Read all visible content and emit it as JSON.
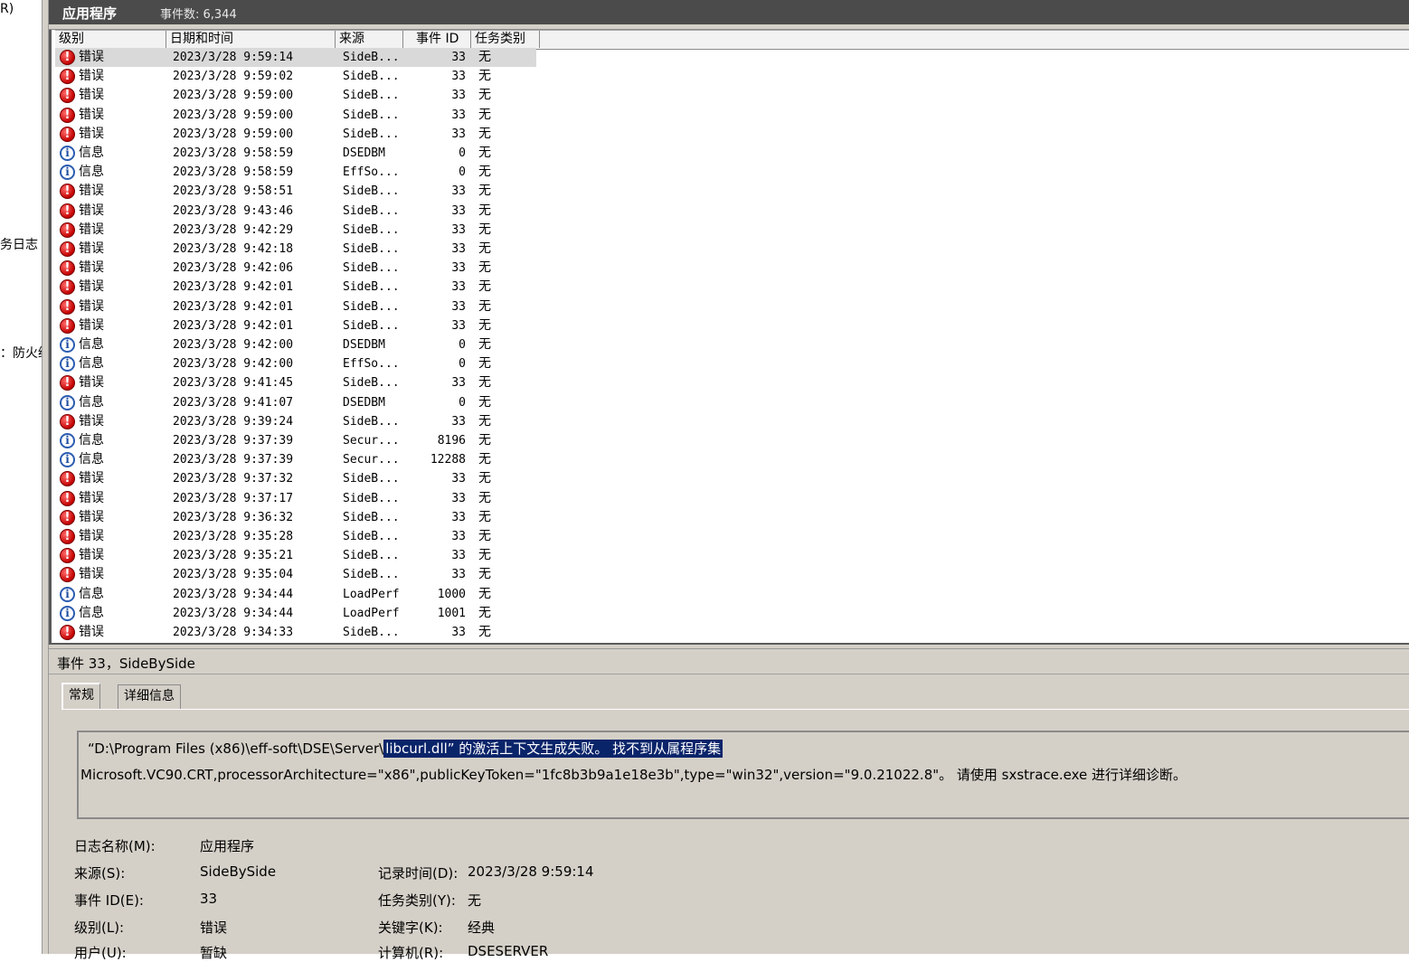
{
  "left_tree": {
    "frag_top": "R)",
    "frag_mid": "务日志",
    "frag_low": "：防火缙"
  },
  "title": {
    "name": "应用程序",
    "count": "事件数: 6,344"
  },
  "columns": {
    "level": "级别",
    "datetime": "日期和时间",
    "source": "来源",
    "event_id": "事件 ID",
    "task": "任务类别"
  },
  "events": [
    {
      "type": "err",
      "level": "错误",
      "dt": "2023/3/28 9:59:14",
      "src": "SideB...",
      "id": "33",
      "task": "无",
      "selected": true
    },
    {
      "type": "err",
      "level": "错误",
      "dt": "2023/3/28 9:59:02",
      "src": "SideB...",
      "id": "33",
      "task": "无"
    },
    {
      "type": "err",
      "level": "错误",
      "dt": "2023/3/28 9:59:00",
      "src": "SideB...",
      "id": "33",
      "task": "无"
    },
    {
      "type": "err",
      "level": "错误",
      "dt": "2023/3/28 9:59:00",
      "src": "SideB...",
      "id": "33",
      "task": "无"
    },
    {
      "type": "err",
      "level": "错误",
      "dt": "2023/3/28 9:59:00",
      "src": "SideB...",
      "id": "33",
      "task": "无"
    },
    {
      "type": "info",
      "level": "信息",
      "dt": "2023/3/28 9:58:59",
      "src": "DSEDBM",
      "id": "0",
      "task": "无"
    },
    {
      "type": "info",
      "level": "信息",
      "dt": "2023/3/28 9:58:59",
      "src": "EffSo...",
      "id": "0",
      "task": "无"
    },
    {
      "type": "err",
      "level": "错误",
      "dt": "2023/3/28 9:58:51",
      "src": "SideB...",
      "id": "33",
      "task": "无"
    },
    {
      "type": "err",
      "level": "错误",
      "dt": "2023/3/28 9:43:46",
      "src": "SideB...",
      "id": "33",
      "task": "无"
    },
    {
      "type": "err",
      "level": "错误",
      "dt": "2023/3/28 9:42:29",
      "src": "SideB...",
      "id": "33",
      "task": "无"
    },
    {
      "type": "err",
      "level": "错误",
      "dt": "2023/3/28 9:42:18",
      "src": "SideB...",
      "id": "33",
      "task": "无"
    },
    {
      "type": "err",
      "level": "错误",
      "dt": "2023/3/28 9:42:06",
      "src": "SideB...",
      "id": "33",
      "task": "无"
    },
    {
      "type": "err",
      "level": "错误",
      "dt": "2023/3/28 9:42:01",
      "src": "SideB...",
      "id": "33",
      "task": "无"
    },
    {
      "type": "err",
      "level": "错误",
      "dt": "2023/3/28 9:42:01",
      "src": "SideB...",
      "id": "33",
      "task": "无"
    },
    {
      "type": "err",
      "level": "错误",
      "dt": "2023/3/28 9:42:01",
      "src": "SideB...",
      "id": "33",
      "task": "无"
    },
    {
      "type": "info",
      "level": "信息",
      "dt": "2023/3/28 9:42:00",
      "src": "DSEDBM",
      "id": "0",
      "task": "无"
    },
    {
      "type": "info",
      "level": "信息",
      "dt": "2023/3/28 9:42:00",
      "src": "EffSo...",
      "id": "0",
      "task": "无"
    },
    {
      "type": "err",
      "level": "错误",
      "dt": "2023/3/28 9:41:45",
      "src": "SideB...",
      "id": "33",
      "task": "无"
    },
    {
      "type": "info",
      "level": "信息",
      "dt": "2023/3/28 9:41:07",
      "src": "DSEDBM",
      "id": "0",
      "task": "无"
    },
    {
      "type": "err",
      "level": "错误",
      "dt": "2023/3/28 9:39:24",
      "src": "SideB...",
      "id": "33",
      "task": "无"
    },
    {
      "type": "info",
      "level": "信息",
      "dt": "2023/3/28 9:37:39",
      "src": "Secur...",
      "id": "8196",
      "task": "无"
    },
    {
      "type": "info",
      "level": "信息",
      "dt": "2023/3/28 9:37:39",
      "src": "Secur...",
      "id": "12288",
      "task": "无"
    },
    {
      "type": "err",
      "level": "错误",
      "dt": "2023/3/28 9:37:32",
      "src": "SideB...",
      "id": "33",
      "task": "无"
    },
    {
      "type": "err",
      "level": "错误",
      "dt": "2023/3/28 9:37:17",
      "src": "SideB...",
      "id": "33",
      "task": "无"
    },
    {
      "type": "err",
      "level": "错误",
      "dt": "2023/3/28 9:36:32",
      "src": "SideB...",
      "id": "33",
      "task": "无"
    },
    {
      "type": "err",
      "level": "错误",
      "dt": "2023/3/28 9:35:28",
      "src": "SideB...",
      "id": "33",
      "task": "无"
    },
    {
      "type": "err",
      "level": "错误",
      "dt": "2023/3/28 9:35:21",
      "src": "SideB...",
      "id": "33",
      "task": "无"
    },
    {
      "type": "err",
      "level": "错误",
      "dt": "2023/3/28 9:35:04",
      "src": "SideB...",
      "id": "33",
      "task": "无"
    },
    {
      "type": "info",
      "level": "信息",
      "dt": "2023/3/28 9:34:44",
      "src": "LoadPerf",
      "id": "1000",
      "task": "无"
    },
    {
      "type": "info",
      "level": "信息",
      "dt": "2023/3/28 9:34:44",
      "src": "LoadPerf",
      "id": "1001",
      "task": "无"
    },
    {
      "type": "err",
      "level": "错误",
      "dt": "2023/3/28 9:34:33",
      "src": "SideB...",
      "id": "33",
      "task": "无"
    }
  ],
  "details": {
    "header": "事件 33，SideBySide",
    "tabs": {
      "general": "常规",
      "detail": "详细信息"
    },
    "message_line1_pre": "“D:\\Program Files (x86)\\eff-soft\\DSE\\Server\\",
    "message_line1_sel": "libcurl.dll” 的激活上下文生成失败。 找不到从属程序集",
    "message_line2": "Microsoft.VC90.CRT,processorArchitecture=\"x86\",publicKeyToken=\"1fc8b3b9a1e18e3b\",type=\"win32\",version=\"9.0.21022.8\"。 请使用 sxstrace.exe 进行详细诊断。",
    "props": {
      "log_name_label": "日志名称(M):",
      "log_name": "应用程序",
      "source_label": "来源(S):",
      "source": "SideBySide",
      "logged_label": "记录时间(D):",
      "logged": "2023/3/28 9:59:14",
      "event_id_label": "事件 ID(E):",
      "event_id": "33",
      "task_label": "任务类别(Y):",
      "task": "无",
      "level_label": "级别(L):",
      "level": "错误",
      "keywords_label": "关键字(K):",
      "keywords": "经典",
      "user_label": "用户(U):",
      "user": "暂缺",
      "computer_label": "计算机(R):",
      "computer": "DSESERVER"
    }
  }
}
